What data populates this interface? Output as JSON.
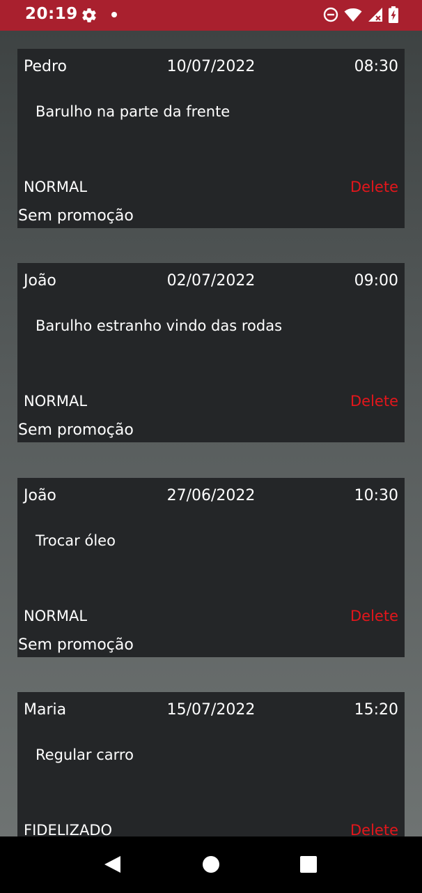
{
  "status_bar": {
    "time": "20:19",
    "background": "#A9202E",
    "icons": [
      "gear-icon",
      "notification-dot-icon",
      "do-not-disturb-icon",
      "wifi-icon",
      "signal-icon",
      "battery-charging-icon"
    ]
  },
  "appointments": [
    {
      "name": "Pedro",
      "date": "10/07/2022",
      "time": "08:30",
      "description": "Barulho na parte da frente",
      "category": "NORMAL",
      "delete_label": "Delete",
      "promotion": "Sem promoção"
    },
    {
      "name": "João",
      "date": "02/07/2022",
      "time": "09:00",
      "description": "Barulho estranho vindo das rodas",
      "category": "NORMAL",
      "delete_label": "Delete",
      "promotion": "Sem promoção"
    },
    {
      "name": "João",
      "date": "27/06/2022",
      "time": "10:30",
      "description": "Trocar óleo",
      "category": "NORMAL",
      "delete_label": "Delete",
      "promotion": "Sem promoção"
    },
    {
      "name": "Maria",
      "date": "15/07/2022",
      "time": "15:20",
      "description": "Regular carro",
      "category": "FIDELIZADO",
      "delete_label": "Delete",
      "promotion": ""
    }
  ],
  "colors": {
    "card_background": "#242628",
    "delete_text": "#E4161B",
    "nav_background": "#000000"
  },
  "nav_bar": {
    "icons": [
      "back-icon",
      "home-icon",
      "recents-icon"
    ]
  }
}
